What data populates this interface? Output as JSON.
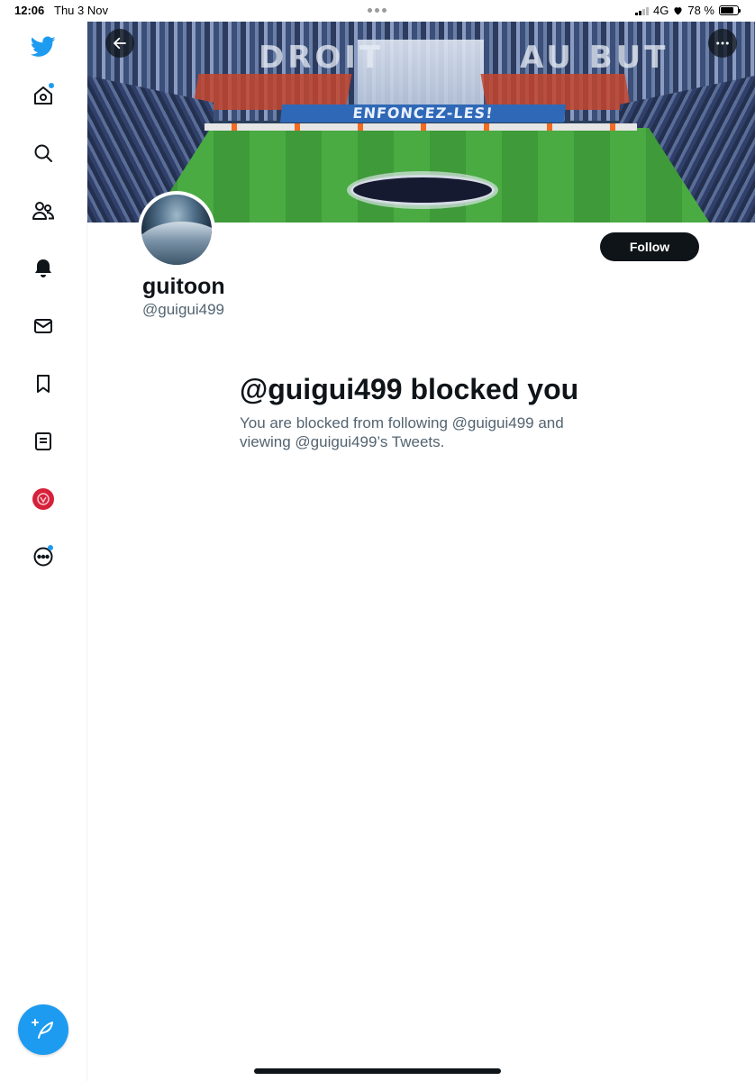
{
  "status_bar": {
    "time": "12:06",
    "date": "Thu 3 Nov",
    "network": "4G",
    "battery_text": "78 %",
    "battery_level": 0.78
  },
  "sidebar": {
    "items": [
      {
        "icon": "twitter-logo-icon"
      },
      {
        "icon": "home-icon",
        "has_dot": true
      },
      {
        "icon": "search-icon"
      },
      {
        "icon": "communities-icon"
      },
      {
        "icon": "notifications-bell-icon"
      },
      {
        "icon": "messages-envelope-icon"
      },
      {
        "icon": "bookmark-icon"
      },
      {
        "icon": "lists-icon"
      },
      {
        "icon": "profile-avatar-icon"
      },
      {
        "icon": "more-options-icon",
        "has_dot": true
      }
    ],
    "compose_icon": "compose-tweet-icon"
  },
  "banner": {
    "board_text": "ENFONCEZ-LES!",
    "tifo_left": "DROIT",
    "tifo_right": "AU BUT"
  },
  "profile": {
    "name": "guitoon",
    "handle": "@guigui499",
    "follow_label": "Follow"
  },
  "blocked": {
    "title": "@guigui499 blocked you",
    "message": "You are blocked from following @guigui499 and viewing @guigui499’s Tweets."
  },
  "colors": {
    "accent": "#1d9bf0",
    "text_primary": "#0f1419",
    "text_secondary": "#536471"
  }
}
